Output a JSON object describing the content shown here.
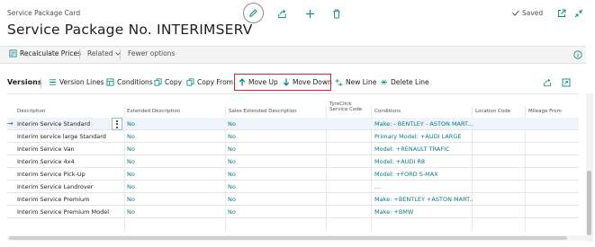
{
  "header": {
    "caption": "Service Package Card",
    "title": "Service Package No. INTERIMSERV",
    "saved_label": "Saved"
  },
  "actionbar": {
    "recalculate": "Recalculate Prices",
    "related": "Related",
    "fewer": "Fewer options"
  },
  "subpage": {
    "title": "Versions",
    "actions": {
      "version_lines": "Version Lines",
      "conditions": "Conditions",
      "copy": "Copy",
      "copy_from": "Copy From",
      "move_up": "Move Up",
      "move_down": "Move Down",
      "new_line": "New Line",
      "delete_line": "Delete Line"
    }
  },
  "table": {
    "headers": {
      "description": "Description",
      "extended": "Extended Description",
      "sales_extended": "Sales Extended Description",
      "tyreclick_1": "TyreClick",
      "tyreclick_2": "Service Code",
      "conditions": "Conditions",
      "location": "Location Code",
      "mileage": "Mileage From"
    },
    "rows": [
      {
        "description": "Interim Service Standard",
        "extended": "No",
        "sales_extended": "No",
        "conditions": "Make: - BENTLEY - ASTON MART..."
      },
      {
        "description": "Interim service large Standard",
        "extended": "No",
        "sales_extended": "No",
        "conditions": "Primary Model: +AUDI LARGE"
      },
      {
        "description": "Interim Service Van",
        "extended": "No",
        "sales_extended": "No",
        "conditions": "Model: +RENAULT TRAFIC"
      },
      {
        "description": "Interim Service 4x4",
        "extended": "No",
        "sales_extended": "No",
        "conditions": "Model: +AUDI R8"
      },
      {
        "description": "Interim Service Pick-Up",
        "extended": "No",
        "sales_extended": "No",
        "conditions": "Model: +FORD S-MAX"
      },
      {
        "description": "Interim Service Landrover",
        "extended": "No",
        "sales_extended": "No",
        "conditions": "..."
      },
      {
        "description": "Interim Service Premium",
        "extended": "No",
        "sales_extended": "No",
        "conditions": "Make: +BENTLEY +ASTON MART..."
      },
      {
        "description": "Interim Service Premium Model",
        "extended": "No",
        "sales_extended": "No",
        "conditions": "Make: +BMW"
      }
    ]
  },
  "colors": {
    "link": "#0a7a85",
    "accent": "#00897b",
    "highlight": "#d9232d"
  }
}
